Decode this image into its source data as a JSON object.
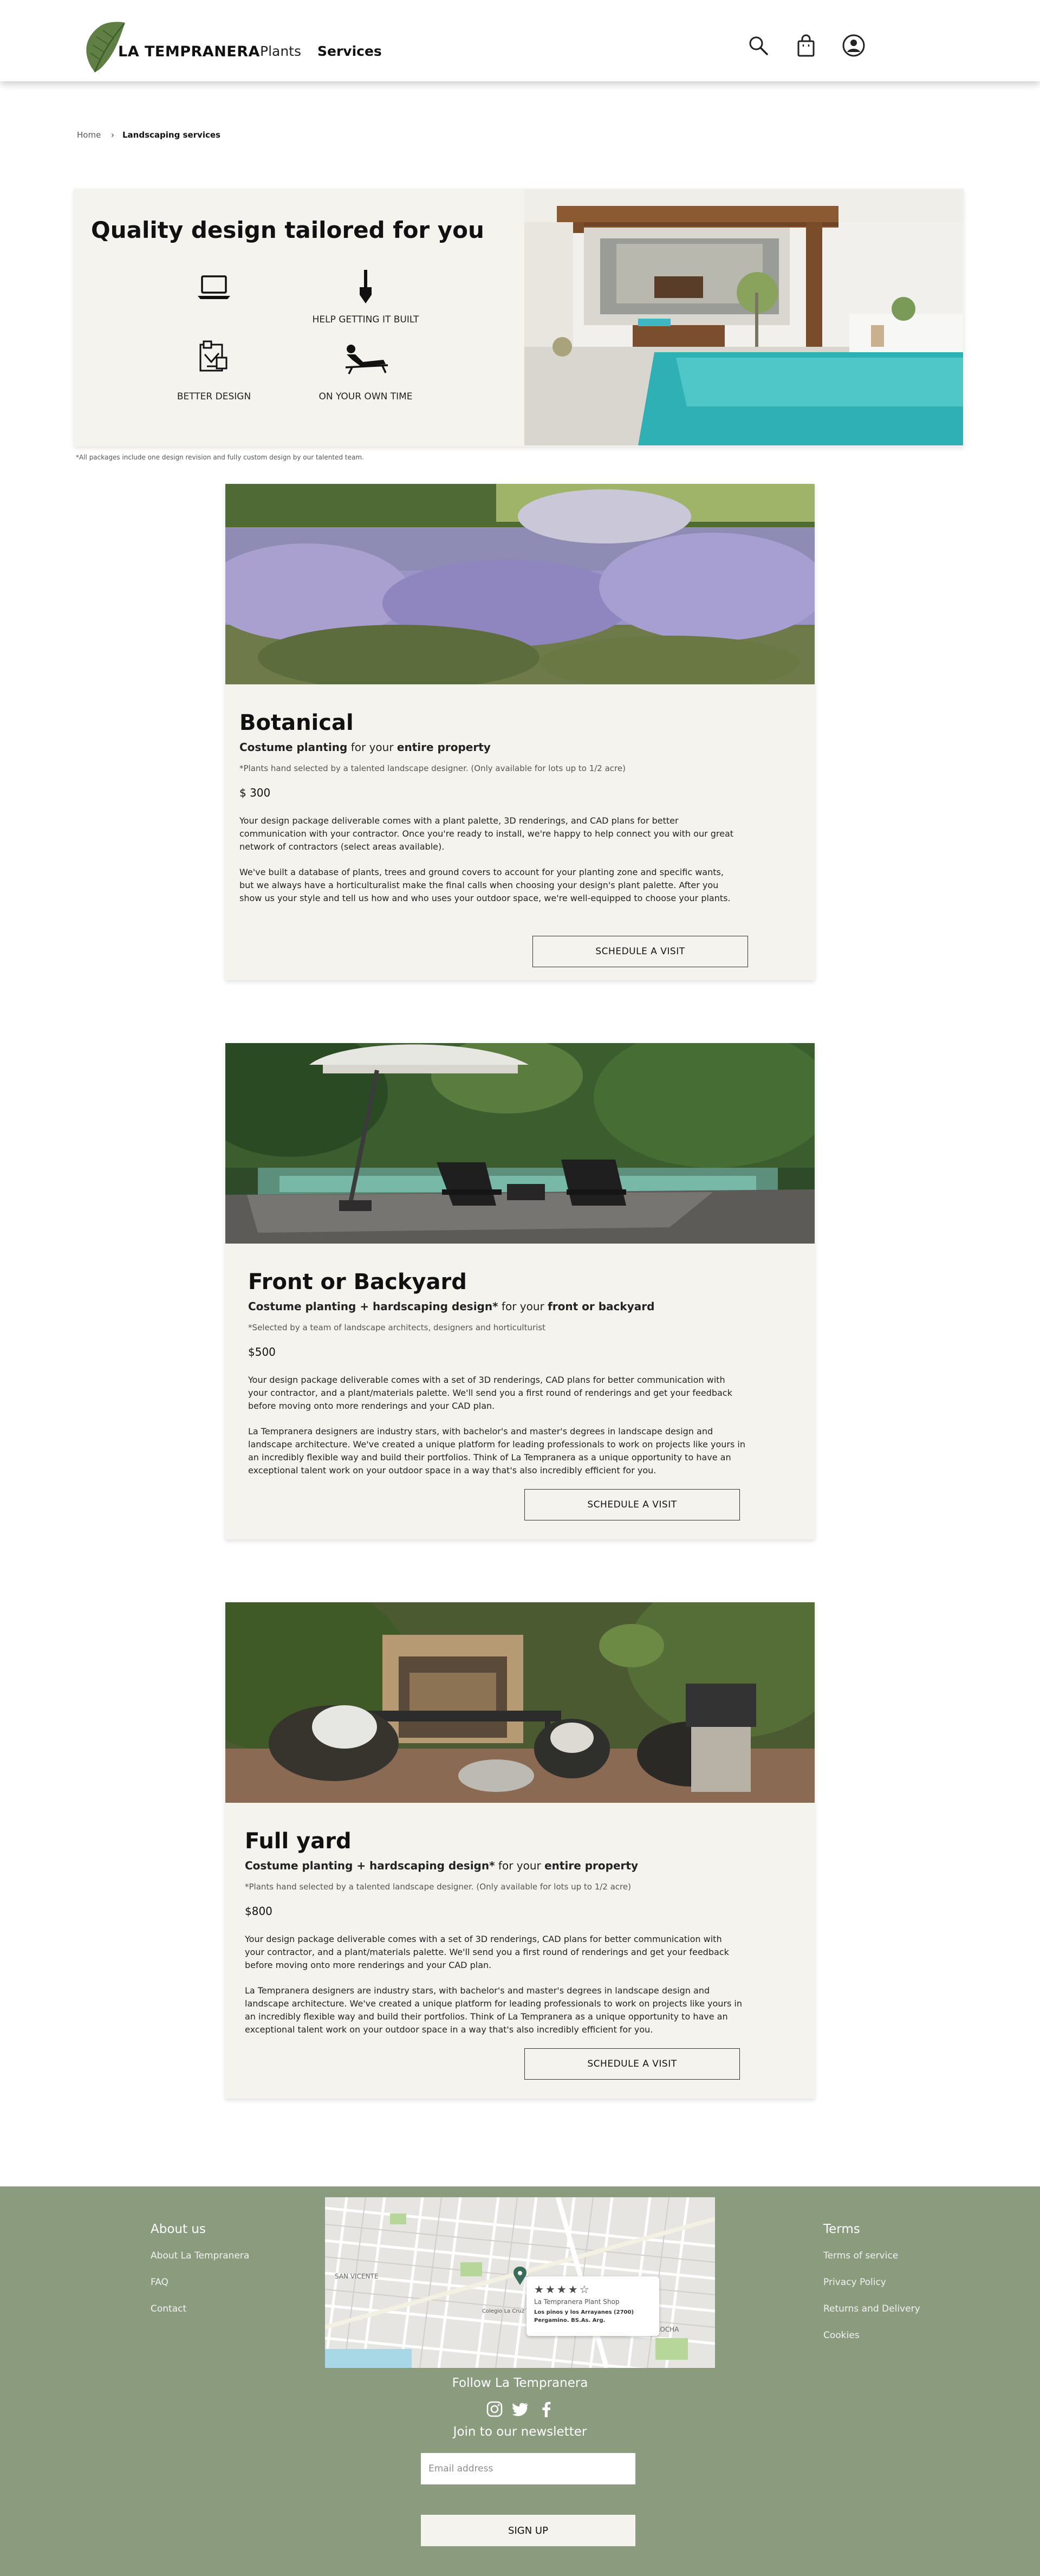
{
  "header": {
    "brand": "LA TEMPRANERA",
    "nav": {
      "plants": "Plants",
      "services": "Services"
    },
    "icons": {
      "search": "search-icon",
      "cart": "shopping-bag-icon",
      "account": "user-circle-icon",
      "logo": "leaf-logo"
    }
  },
  "breadcrumb": {
    "home": "Home",
    "separator": "›",
    "current": "Landscaping services"
  },
  "hero": {
    "title": "Quality design tailored for you",
    "features": [
      {
        "icon": "laptop-icon",
        "label": ""
      },
      {
        "icon": "shovel-icon",
        "label": "HELP GETTING IT BUILT"
      },
      {
        "icon": "blueprint-icon",
        "label": "BETTER DESIGN"
      },
      {
        "icon": "lounge-chair-icon",
        "label": "ON YOUR OWN TIME"
      }
    ],
    "disclaimer": "*All packages include one design revision and fully custom design by our talented team."
  },
  "packages": [
    {
      "title": "Botanical",
      "sub_bold": "Costume planting",
      "sub_mid": " for your ",
      "sub_end": "entire property",
      "note": "*Plants hand selected by a talented landscape designer. (Only available for lots up to 1/2 acre)",
      "price": "$ 300",
      "p1": "Your design package deliverable comes with a plant palette, 3D renderings, and CAD plans for better communication with your contractor. Once you're ready to install, we're happy to help connect you with our great network of contractors (select areas available).",
      "p2": "We've built a database of plants, trees and ground covers to account for your planting zone and specific wants, but we always have a horticulturalist make the final calls when choosing your design's plant palette. After you show us your style and tell us how and who uses your outdoor space, we're well-equipped to choose your plants.",
      "button": "SCHEDULE A VISIT"
    },
    {
      "title": "Front or Backyard",
      "sub_bold": "Costume planting + hardscaping design*",
      "sub_mid": " for your ",
      "sub_end": "front or backyard",
      "note": "*Selected by a team of landscape architects, designers and horticulturist",
      "price": "$500",
      "p1": "Your design package deliverable comes with a set of 3D renderings, CAD plans for better communication with your contractor, and a plant/materials palette. We'll send you a first round of renderings and get your feedback before moving onto more renderings and your CAD plan.",
      "p2": "La Tempranera designers are industry stars, with bachelor's and master's degrees in landscape design and landscape architecture. We've created a unique platform for leading professionals to work on projects like yours in an incredibly flexible way and build their portfolios. Think of La Tempranera as a unique opportunity to have an exceptional talent work on your outdoor space in a way that's also incredibly efficient for you.",
      "button": "SCHEDULE A VISIT"
    },
    {
      "title": "Full yard",
      "sub_bold": "Costume planting + hardscaping design*",
      "sub_mid": " for your ",
      "sub_end": "entire property",
      "note": "*Plants hand selected by a talented landscape designer. (Only available for lots up to 1/2 acre)",
      "price": "$800",
      "p1": "Your design package deliverable comes with a set of 3D renderings, CAD plans for better communication with your contractor, and a plant/materials palette. We'll send you a first round of renderings and get your feedback before moving onto more renderings and your CAD plan.",
      "p2": "La Tempranera designers are industry stars, with bachelor's and master's degrees in landscape design and landscape architecture. We've created a unique platform for leading professionals to work on projects like yours in an incredibly flexible way and build their portfolios. Think of La Tempranera as a unique opportunity to have an exceptional talent work on your outdoor space in a way that's also incredibly efficient for you.",
      "button": "SCHEDULE A VISIT"
    }
  ],
  "footer": {
    "about": {
      "heading": "About us",
      "links": [
        "About La Tempranera",
        "FAQ",
        "Contact"
      ]
    },
    "terms": {
      "heading": "Terms",
      "links": [
        "Terms of service",
        "Privacy Policy",
        "Returns and Delivery",
        "Cookies"
      ]
    },
    "map": {
      "stars": "★★★★☆",
      "shop": "La Tempranera Plant Shop",
      "address_line1": "Los pinos y los Arrayanes (2700)",
      "address_line2": "Pergamino. BS.As. Arg.",
      "labels": [
        "SAN VICENTE",
        "ROCHA",
        "Colegio La Cruz"
      ]
    },
    "follow": "Follow La Tempranera",
    "newsletter": "Join to our newsletter",
    "email_placeholder": "Email address",
    "signup": "SIGN UP",
    "colors": {
      "background": "#8a9b7e",
      "card": "#f5f3ee"
    }
  }
}
